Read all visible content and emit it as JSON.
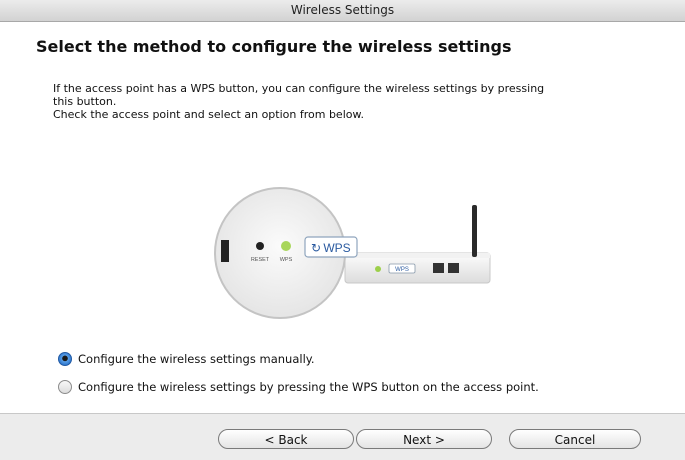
{
  "window": {
    "title": "Wireless Settings"
  },
  "heading": "Select the method to configure the wireless settings",
  "description": {
    "line1": "If the access point has a WPS button, you can configure the wireless settings by pressing",
    "line2": "this button.",
    "line3": "Check the access point and select an option from below."
  },
  "illustration": {
    "reset_label": "RESET",
    "wps_led_label": "WPS",
    "wps_button_label": "WPS",
    "router_wps_label": "WPS"
  },
  "options": [
    {
      "label": "Configure the wireless settings manually.",
      "selected": true
    },
    {
      "label": "Configure the wireless settings by pressing the WPS button on the access point.",
      "selected": false
    }
  ],
  "buttons": {
    "back": "< Back",
    "next": "Next >",
    "cancel": "Cancel"
  }
}
